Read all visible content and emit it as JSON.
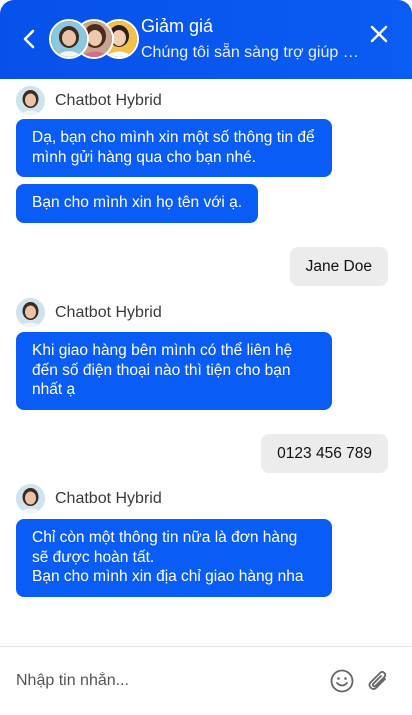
{
  "colors": {
    "header_blue": "#0651ea",
    "bot_bubble": "#0a5cf6",
    "user_bubble": "#ececec"
  },
  "header": {
    "back_icon": "chevron-left-icon",
    "title": "Giảm giá",
    "subtitle": "Chúng tôi sẵn sàng trợ giúp bạn",
    "close_icon": "close-icon"
  },
  "messages": [
    {
      "from": "bot",
      "sender_name": "Chatbot Hybrid",
      "bubbles": [
        "Dạ, bạn cho mình xin một số thông tin để mình gửi hàng qua cho bạn nhé.",
        "Bạn cho mình xin họ tên với ạ."
      ]
    },
    {
      "from": "user",
      "text": "Jane Doe"
    },
    {
      "from": "bot",
      "sender_name": "Chatbot Hybrid",
      "bubbles": [
        "Khi giao hàng bên mình có thể liên hệ đến số điện thoại nào thì tiện cho bạn nhất ạ"
      ]
    },
    {
      "from": "user",
      "text": "0123 456 789"
    },
    {
      "from": "bot",
      "sender_name": "Chatbot Hybrid",
      "bubbles": [
        "Chỉ còn một thông tin nữa là đơn hàng sẽ được hoàn tất.\nBạn cho mình xin địa chỉ giao hàng nha"
      ]
    }
  ],
  "composer": {
    "placeholder": "Nhập tin nhắn...",
    "emoji_icon": "smiley-icon",
    "attach_icon": "paperclip-icon"
  }
}
